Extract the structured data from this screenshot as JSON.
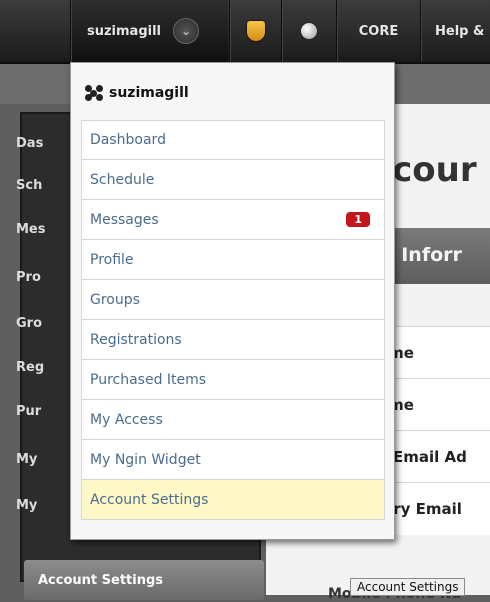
{
  "topbar": {
    "username": "suzimagill",
    "core_label": "CORE",
    "help_label": "Help &"
  },
  "sidebar": {
    "items": [
      "Das",
      "Sch",
      "Mes",
      "Pro",
      "Gro",
      "Reg",
      "Pur",
      "My",
      "My"
    ],
    "active_label": "Account Settings"
  },
  "content": {
    "heading": "ccour",
    "section_title": "nt Inforr",
    "fields": [
      "ame",
      "ame",
      "y Email Ad",
      "lary Email"
    ],
    "mobile_label": "Mobile Phone Nu"
  },
  "dropdown": {
    "header": "suzimagill",
    "items": [
      {
        "label": "Dashboard"
      },
      {
        "label": "Schedule"
      },
      {
        "label": "Messages",
        "badge": "1"
      },
      {
        "label": "Profile"
      },
      {
        "label": "Groups"
      },
      {
        "label": "Registrations"
      },
      {
        "label": "Purchased Items"
      },
      {
        "label": "My Access"
      },
      {
        "label": "My Ngin Widget"
      },
      {
        "label": "Account Settings"
      }
    ],
    "selected_index": 9,
    "badge_color": "#c4161c"
  },
  "tooltip": "Account Settings"
}
